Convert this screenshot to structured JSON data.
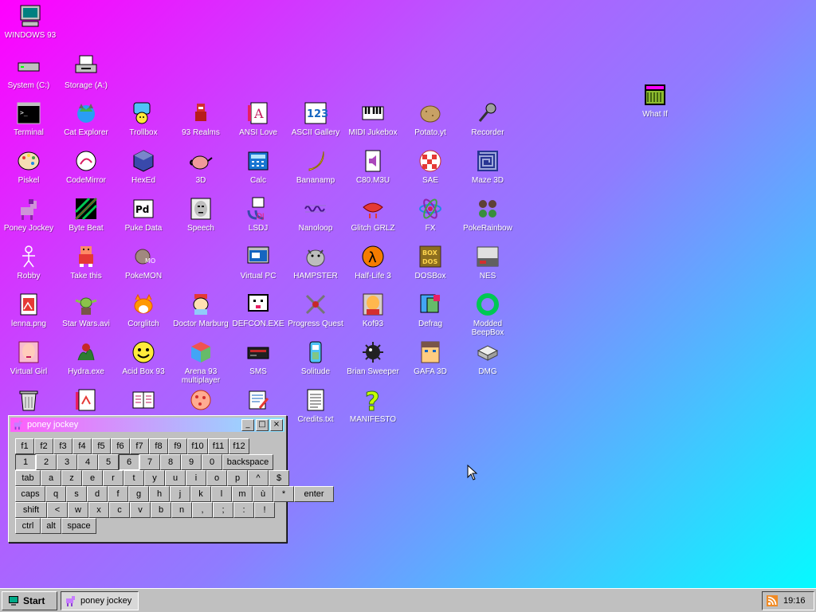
{
  "desktop": {
    "icons": [
      {
        "label": "WINDOWS 93",
        "icon": "computer-icon"
      },
      {
        "label": "System (C:)",
        "icon": "drive-icon"
      },
      {
        "label": "Storage (A:)",
        "icon": "floppy-drive-icon"
      },
      {
        "label": "What If",
        "icon": "what-if-icon"
      },
      {
        "label": "Terminal",
        "icon": "terminal-icon"
      },
      {
        "label": "Cat Explorer",
        "icon": "cat-explorer-icon"
      },
      {
        "label": "Trollbox",
        "icon": "trollbox-icon"
      },
      {
        "label": "93 Realms",
        "icon": "realms-icon"
      },
      {
        "label": "ANSI Love",
        "icon": "ansi-love-icon"
      },
      {
        "label": "ASCII Gallery",
        "icon": "ascii-gallery-icon"
      },
      {
        "label": "MIDI Jukebox",
        "icon": "piano-icon"
      },
      {
        "label": "Potato.yt",
        "icon": "potato-icon"
      },
      {
        "label": "Recorder",
        "icon": "microphone-icon"
      },
      {
        "label": "Piskel",
        "icon": "palette-icon"
      },
      {
        "label": "CodeMirror",
        "icon": "codemirror-icon"
      },
      {
        "label": "HexEd",
        "icon": "cube-icon"
      },
      {
        "label": "3D",
        "icon": "teapot-icon"
      },
      {
        "label": "Calc",
        "icon": "calculator-icon"
      },
      {
        "label": "Bananamp",
        "icon": "banana-icon"
      },
      {
        "label": "C80.M3U",
        "icon": "audio-file-icon"
      },
      {
        "label": "SAE",
        "icon": "amiga-ball-icon"
      },
      {
        "label": "Maze 3D",
        "icon": "maze-icon"
      },
      {
        "label": "Poney Jockey",
        "icon": "pony-icon"
      },
      {
        "label": "Byte Beat",
        "icon": "bytebeat-icon"
      },
      {
        "label": "Puke Data",
        "icon": "puredata-icon"
      },
      {
        "label": "Speech",
        "icon": "face-icon"
      },
      {
        "label": "LSDJ",
        "icon": "gameboy-icon"
      },
      {
        "label": "Nanoloop",
        "icon": "wave-icon"
      },
      {
        "label": "Glitch GRLZ",
        "icon": "lips-icon"
      },
      {
        "label": "FX",
        "icon": "atom-icon"
      },
      {
        "label": "PokeRainbow",
        "icon": "pokerainbow-icon"
      },
      {
        "label": "Robby",
        "icon": "stickman-icon"
      },
      {
        "label": "Take this",
        "icon": "take-this-icon"
      },
      {
        "label": "PokeMON",
        "icon": "pokemon-icon"
      },
      {
        "label": "Virtual PC",
        "icon": "virtual-pc-icon"
      },
      {
        "label": "HAMPSTER",
        "icon": "hamster-icon"
      },
      {
        "label": "Half-Life 3",
        "icon": "lambda-icon"
      },
      {
        "label": "DOSBox",
        "icon": "dosbox-icon"
      },
      {
        "label": "NES",
        "icon": "nes-icon"
      },
      {
        "label": "lenna.png",
        "icon": "image-file-icon"
      },
      {
        "label": "Star Wars.avi",
        "icon": "yoda-icon"
      },
      {
        "label": "Corglitch",
        "icon": "corgi-icon"
      },
      {
        "label": "Doctor Marburg",
        "icon": "doctor-icon"
      },
      {
        "label": "DEFCON.EXE",
        "icon": "defcon-icon"
      },
      {
        "label": "Progress Quest",
        "icon": "swords-icon"
      },
      {
        "label": "Kof93",
        "icon": "fighter-icon"
      },
      {
        "label": "Defrag",
        "icon": "defrag-icon"
      },
      {
        "label": "Modded BeepBox",
        "icon": "ring-icon"
      },
      {
        "label": "Virtual Girl",
        "icon": "virtual-girl-icon"
      },
      {
        "label": "Hydra.exe",
        "icon": "hydra-icon"
      },
      {
        "label": "Acid Box 93",
        "icon": "smiley-icon"
      },
      {
        "label": "Arena 93 multiplayer",
        "icon": "arena-cube-icon"
      },
      {
        "label": "SMS",
        "icon": "sms-console-icon"
      },
      {
        "label": "Solitude",
        "icon": "solitude-icon"
      },
      {
        "label": "Brian Sweeper",
        "icon": "mine-icon"
      },
      {
        "label": "GAFA 3D",
        "icon": "gafa-face-icon"
      },
      {
        "label": "DMG",
        "icon": "dmg-icon"
      },
      {
        "label": "",
        "icon": "recycle-bin-icon"
      },
      {
        "label": "",
        "icon": "document-icon"
      },
      {
        "label": "",
        "icon": "book-icon"
      },
      {
        "label": "",
        "icon": "cookie-icon"
      },
      {
        "label": "",
        "icon": "notepad-icon"
      },
      {
        "label": "Credits.txt",
        "icon": "text-file-icon"
      },
      {
        "label": "MANIFESTO",
        "icon": "question-mark-icon"
      }
    ]
  },
  "window": {
    "title": "poney jockey",
    "minimize": "_",
    "maximize": "□",
    "close": "×",
    "keyboard": {
      "rows": [
        [
          "f1",
          "f2",
          "f3",
          "f4",
          "f5",
          "f6",
          "f7",
          "f8",
          "f9",
          "f10",
          "f11",
          "f12"
        ],
        [
          "1",
          "2",
          "3",
          "4",
          "5",
          "6",
          "7",
          "8",
          "9",
          "0",
          "backspace"
        ],
        [
          "tab",
          "a",
          "z",
          "e",
          "r",
          "t",
          "y",
          "u",
          "i",
          "o",
          "p",
          "^",
          "$"
        ],
        [
          "caps",
          "q",
          "s",
          "d",
          "f",
          "g",
          "h",
          "j",
          "k",
          "l",
          "m",
          "ù",
          "*",
          "enter"
        ],
        [
          "shift",
          "<",
          "w",
          "x",
          "c",
          "v",
          "b",
          "n",
          ",",
          ";",
          ":",
          "!"
        ],
        [
          "ctrl",
          "alt",
          "space"
        ]
      ]
    }
  },
  "taskbar": {
    "start_label": "Start",
    "items": [
      {
        "label": "poney jockey"
      }
    ],
    "clock": "19:16"
  }
}
